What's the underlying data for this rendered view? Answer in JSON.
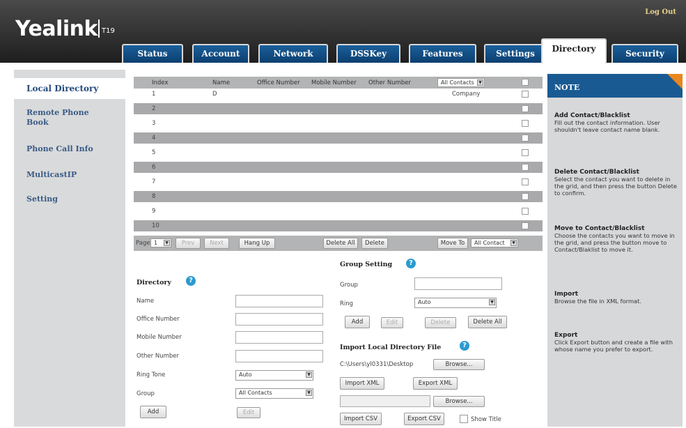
{
  "header": {
    "logo": "Yealink",
    "model": "T19",
    "logout": "Log Out"
  },
  "tabs": [
    {
      "label": "Status"
    },
    {
      "label": "Account"
    },
    {
      "label": "Network"
    },
    {
      "label": "DSSKey"
    },
    {
      "label": "Features"
    },
    {
      "label": "Settings"
    },
    {
      "label": "Directory"
    },
    {
      "label": "Security"
    }
  ],
  "active_tab": "Directory",
  "sidebar": {
    "items": [
      {
        "label": "Local Directory"
      },
      {
        "label": "Remote Phone Book"
      },
      {
        "label": "Phone Call Info"
      },
      {
        "label": "MulticastIP"
      },
      {
        "label": "Setting"
      }
    ]
  },
  "grid": {
    "columns": [
      "Index",
      "Name",
      "Office Number",
      "Mobile Number",
      "Other Number"
    ],
    "group_filter": "All Contacts",
    "rows": [
      {
        "index": "1",
        "name": "D",
        "group": "Company"
      },
      {
        "index": "2",
        "name": "",
        "group": ""
      },
      {
        "index": "3",
        "name": "",
        "group": ""
      },
      {
        "index": "4",
        "name": "",
        "group": ""
      },
      {
        "index": "5",
        "name": "",
        "group": ""
      },
      {
        "index": "6",
        "name": "",
        "group": ""
      },
      {
        "index": "7",
        "name": "",
        "group": ""
      },
      {
        "index": "8",
        "name": "",
        "group": ""
      },
      {
        "index": "9",
        "name": "",
        "group": ""
      },
      {
        "index": "10",
        "name": "",
        "group": ""
      }
    ],
    "pager": {
      "page_label": "Page",
      "page_value": "1",
      "prev": "Prev",
      "next": "Next",
      "hang_up": "Hang Up",
      "delete_all": "Delete All",
      "delete": "Delete",
      "move_to": "Move To",
      "move_target": "All Contact"
    }
  },
  "directory": {
    "title": "Directory",
    "name_label": "Name",
    "office_label": "Office Number",
    "mobile_label": "Mobile Number",
    "other_label": "Other Number",
    "ring_label": "Ring Tone",
    "ring_value": "Auto",
    "group_label": "Group",
    "group_value": "All Contacts",
    "add": "Add",
    "edit": "Edit"
  },
  "group_setting": {
    "title": "Group Setting",
    "group_label": "Group",
    "ring_label": "Ring",
    "ring_value": "Auto",
    "add": "Add",
    "edit": "Edit",
    "delete": "Delete",
    "delete_all": "Delete All"
  },
  "import": {
    "title": "Import Local Directory File",
    "path": "C:\\Users\\yl0331\\Desktop",
    "browse": "Browse...",
    "import_xml": "Import XML",
    "export_xml": "Export XML",
    "import_csv": "Import CSV",
    "export_csv": "Export CSV",
    "show_title": "Show Title"
  },
  "note": {
    "header": "NOTE",
    "sections": [
      {
        "title": "Add Contact/Blacklist",
        "text": "Fill out the contact information. User shouldn't leave contact name blank."
      },
      {
        "title": "Delete Contact/Blacklist",
        "text": "Select the contact you want to delete in the grid, and then press the button Delete to confirm."
      },
      {
        "title": "Move to Contact/Blacklist",
        "text": "Choose the contacts you want to move in the grid, and press the button move to Contact/Blaklist to move it."
      },
      {
        "title": "Import",
        "text": "Browse the file in XML format."
      },
      {
        "title": "Export",
        "text": "Click Export button and create a file with whose name you prefer to export."
      }
    ]
  },
  "colors": {
    "tab_blue": "#0c3f70",
    "nav_text": "#3a5b86",
    "note_orange": "#e8861f",
    "help_blue": "#2b9ad0"
  }
}
